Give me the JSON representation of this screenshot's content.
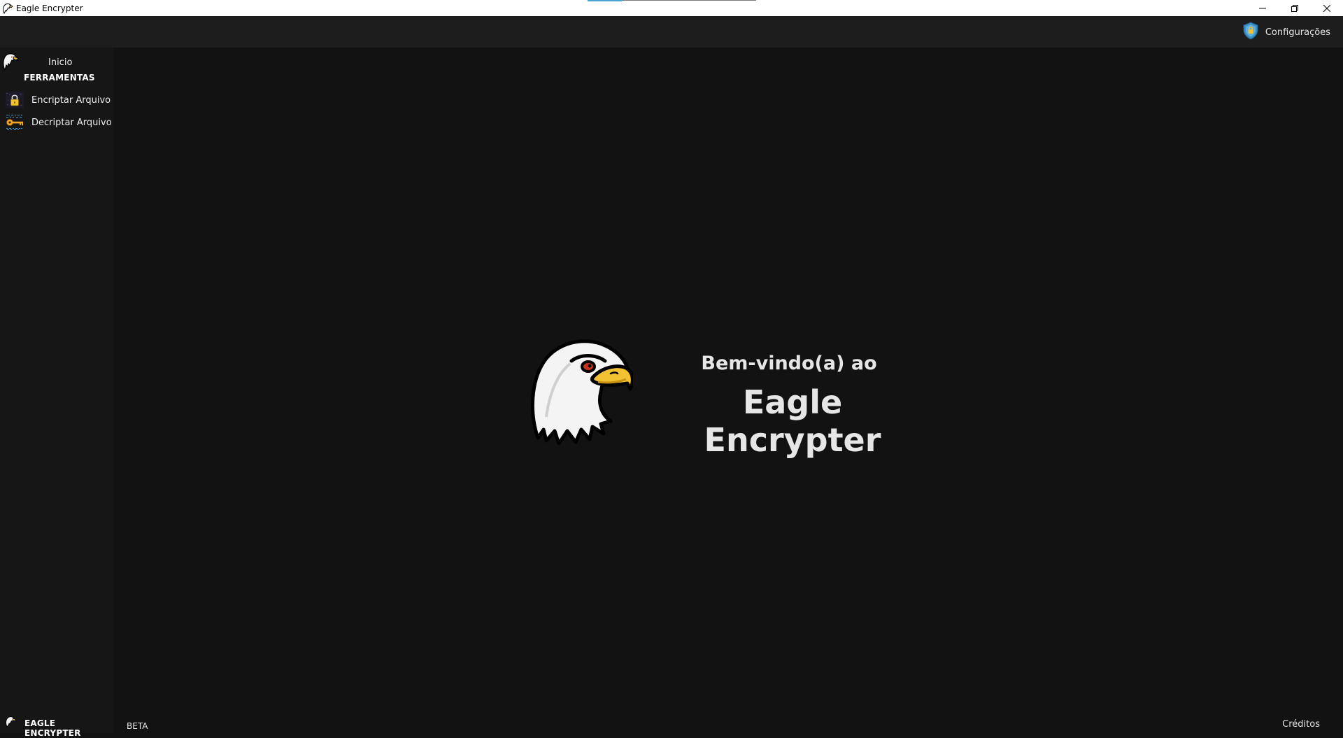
{
  "window": {
    "title": "Eagle Encrypter",
    "controls": {
      "minimize_icon": "minimize-icon",
      "restore_icon": "restore-icon",
      "close_icon": "close-icon"
    }
  },
  "topbar": {
    "settings_label": "Configurações",
    "settings_icon": "shield-lock-icon"
  },
  "sidebar": {
    "home": {
      "label": "Inicio",
      "icon": "eagle-icon"
    },
    "section_title": "FERRAMENTAS",
    "items": [
      {
        "label": "Encriptar Arquivo",
        "icon": "lock-icon"
      },
      {
        "label": "Decriptar Arquivo",
        "icon": "key-icon"
      }
    ],
    "footer_label": "EAGLE ENCRYPTER"
  },
  "main": {
    "welcome": "Bem-vindo(a) ao",
    "app_name": "Eagle Encrypter",
    "beta_label": "BETA",
    "credits_label": "Créditos"
  },
  "colors": {
    "background": "#121213",
    "sidebar": "#161617",
    "topbar": "#1d1d1e",
    "text": "#e6e6e6",
    "beak": "#f2c233",
    "eye": "#c8321f"
  }
}
